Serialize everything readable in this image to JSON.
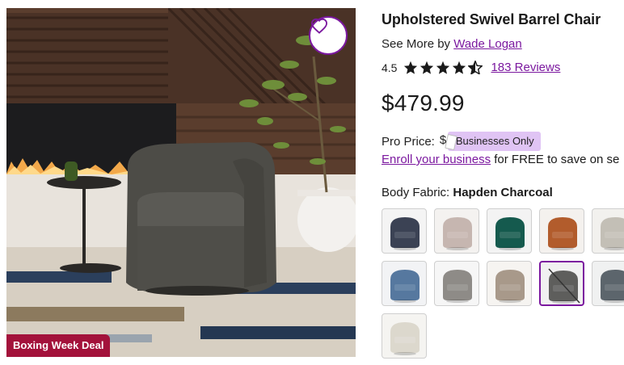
{
  "product": {
    "title": "Upholstered Swivel Barrel Chair",
    "see_more_prefix": "See More by ",
    "brand": "Wade Logan",
    "rating": "4.5",
    "rating_value": 4.5,
    "reviews_label": "183 Reviews",
    "price": "$479.99"
  },
  "pro": {
    "label": "Pro Price:",
    "price_fragment": "$",
    "badge": "Businesses Only",
    "enroll_link": "Enroll your business",
    "enroll_suffix": " for FREE to save on se"
  },
  "fabric": {
    "label": "Body Fabric: ",
    "selected": "Hapden Charcoal",
    "swatches": [
      {
        "color": "#3b4254",
        "bg": "#f4f4f4",
        "selected": false
      },
      {
        "color": "#c6b6b0",
        "bg": "#f4f2f0",
        "selected": false
      },
      {
        "color": "#155a4e",
        "bg": "#f3f3f3",
        "selected": false
      },
      {
        "color": "#b25c2c",
        "bg": "#f4f1ee",
        "selected": false
      },
      {
        "color": "#c3bfb6",
        "bg": "#f2f1ee",
        "selected": false
      },
      {
        "color": "#56789f",
        "bg": "#f2f3f5",
        "selected": false
      },
      {
        "color": "#8e8b87",
        "bg": "#f6f6f6",
        "selected": false
      },
      {
        "color": "#a8998a",
        "bg": "#f6f4f1",
        "selected": false
      },
      {
        "color": "#5e5e5c",
        "bg": "#f1f1f1",
        "selected": true,
        "unavailable": true
      },
      {
        "color": "#5c656c",
        "bg": "#f0f1f1",
        "selected": false
      },
      {
        "color": "#dcd8cd",
        "bg": "#f5f4f1",
        "selected": false
      }
    ]
  },
  "image": {
    "badge": "Boxing Week Deal",
    "favorite_icon": "heart-icon"
  },
  "colors": {
    "accent": "#7b189f",
    "deal_badge": "#a3123b",
    "pro_badge": "#e0c4f4",
    "star": "#1a1a1a"
  }
}
